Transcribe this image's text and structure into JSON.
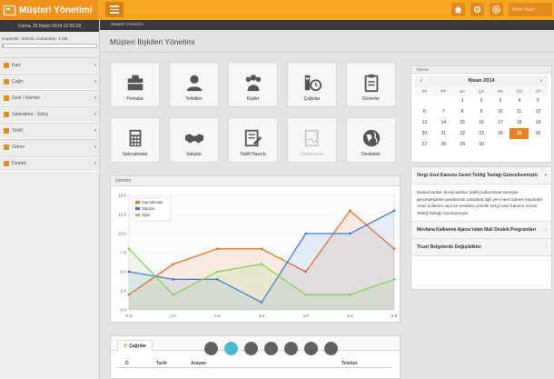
{
  "app": {
    "title": "Müşteri Yönetimi"
  },
  "topbar": {
    "icons": [
      "home-icon",
      "gear-icon",
      "close-icon"
    ],
    "user_label": "Birim Yazılı"
  },
  "sidebar": {
    "datetime": "Cuma, 25 Nisan 2014 12:05:28",
    "capacity": "Kapasite: 200Gb, Kullanılan: 1 Mb",
    "capacity_fraction": 0.005,
    "items": [
      {
        "label": "Kart"
      },
      {
        "label": "Çağrı"
      },
      {
        "label": "Stok / Hizmet"
      },
      {
        "label": "Satınalma - Satış"
      },
      {
        "label": "Teklif"
      },
      {
        "label": "Görev"
      },
      {
        "label": "Destek"
      }
    ]
  },
  "breadcrumb": "Müşteri Yönetimi",
  "page_title": "Müşteri İlişkileri Yönetimi",
  "tiles": [
    {
      "label": "Firmalar",
      "icon": "building-icon",
      "enabled": true
    },
    {
      "label": "Yetkililer",
      "icon": "person-icon",
      "enabled": true
    },
    {
      "label": "Kişiler",
      "icon": "people-icon",
      "enabled": true
    },
    {
      "label": "Çağrılar",
      "icon": "call-log-icon",
      "enabled": true
    },
    {
      "label": "Görevler",
      "icon": "clipboard-icon",
      "enabled": true
    },
    {
      "label": "Satınalmalar",
      "icon": "calculator-icon",
      "enabled": true
    },
    {
      "label": "Satışlar",
      "icon": "handshake-icon",
      "enabled": true
    },
    {
      "label": "Teklif Hazırla",
      "icon": "edit-document-icon",
      "enabled": true
    },
    {
      "label": "Sözleşmeler",
      "icon": "contract-icon",
      "enabled": false
    },
    {
      "label": "Destekler",
      "icon": "globe-icon",
      "enabled": true
    }
  ],
  "chart_panel": {
    "title": "İşlemler"
  },
  "chart_data": {
    "type": "line",
    "x": [
      0.0,
      1.0,
      2.0,
      3.0,
      4.0,
      5.0,
      6.0
    ],
    "xticks": [
      "0.0",
      "1.0",
      "2.0",
      "3.0",
      "4.0",
      "5.0",
      "6.0"
    ],
    "x_points": [
      0,
      1,
      2,
      3,
      4,
      5,
      6,
      7
    ],
    "x_data": [
      0.0,
      0.85,
      1.95,
      2.95,
      4.0,
      5.0,
      6.0
    ],
    "yticks": [
      "0.0",
      "2.5",
      "5.0",
      "7.5",
      "10.0",
      "12.5",
      "15.0"
    ],
    "ylim": [
      0,
      15
    ],
    "xlim": [
      0,
      6
    ],
    "area": true,
    "legend_position": "top-left",
    "series": [
      {
        "name": "Satınalmalar",
        "color": "#e8742a",
        "x": [
          0,
          1,
          2,
          3,
          4,
          5,
          6
        ],
        "values": [
          2,
          6,
          8,
          8,
          5,
          13,
          8
        ]
      },
      {
        "name": "Satışlar",
        "color": "#3b7ad8",
        "x": [
          0,
          1,
          2,
          3,
          4,
          5,
          6
        ],
        "values": [
          5,
          4,
          4,
          1,
          10,
          10,
          13
        ]
      },
      {
        "name": "Öğer",
        "color": "#86d05a",
        "x": [
          0,
          1,
          2,
          3,
          4,
          5,
          6
        ],
        "values": [
          8,
          2,
          5,
          6,
          2,
          2,
          4
        ]
      }
    ]
  },
  "calendar": {
    "panel_title": "Takvim",
    "month_label": "Nisan 2014",
    "prev": "‹",
    "next": "›",
    "weekdays": [
      "PA",
      "PT",
      "SA",
      "ÇA",
      "PE",
      "CU",
      "CT"
    ],
    "days": [
      "30",
      "31",
      "1",
      "2",
      "3",
      "4",
      "5",
      "6",
      "7",
      "8",
      "9",
      "10",
      "11",
      "12",
      "13",
      "14",
      "15",
      "16",
      "17",
      "18",
      "19",
      "20",
      "21",
      "22",
      "23",
      "24",
      "25",
      "26",
      "27",
      "28",
      "29",
      "30",
      "1",
      "2",
      "3"
    ],
    "muted_indices": [
      0,
      1,
      32,
      33,
      34
    ],
    "today": "25"
  },
  "news": {
    "items": [
      {
        "title": "Vergi Usul Kanunu Genel Tebliğ Taslağı Güncellenmiştir.",
        "body": "Banka kartları (kredi kartları dahil) kullanılmak suretiyle gerçekleştirilen perakende satışlarla ilgili yeni nesil ödeme kaydedici cihaz kullanım usul ve esaslara yönelik Vergi Usul Kanunu Genel Tebliğ Taslağı hazırlanmıştır.",
        "expanded": true
      },
      {
        "title": "Mevlana Kalkınma Ajansı'ndan Mali Destek Programları",
        "expanded": false
      },
      {
        "title": "Ticari Belgelerde Değişiklikler",
        "expanded": false
      }
    ]
  },
  "calls": {
    "tab_label": "Çağrılar",
    "columns": [
      "D",
      "Tarih",
      "Arayan",
      "Telefon"
    ]
  },
  "pager": {
    "count": 7,
    "active_index": 1
  }
}
